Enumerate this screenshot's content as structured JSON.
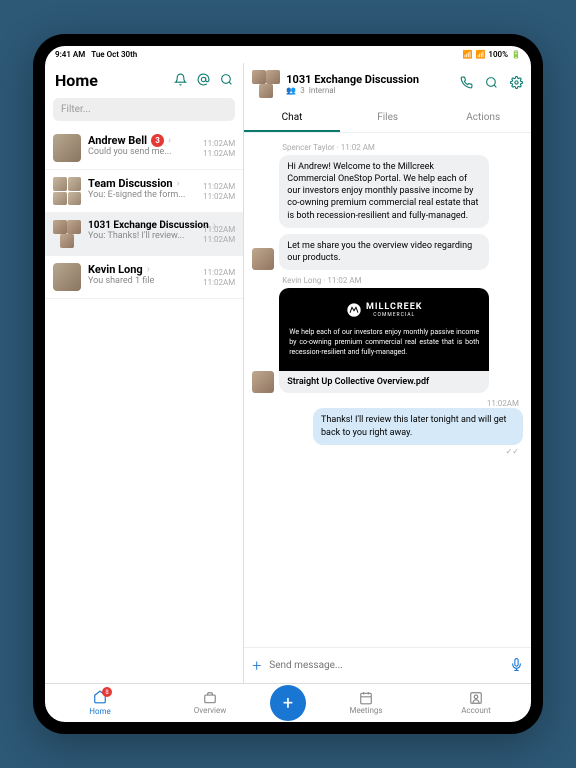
{
  "status": {
    "time": "9:41 AM",
    "date": "Tue Oct 30th",
    "wifi": "100%"
  },
  "home": {
    "title": "Home",
    "filter": "Filter..."
  },
  "conversations": [
    {
      "name": "Andrew Bell",
      "preview": "Could you send me...",
      "time": "11:02AM",
      "time2": "11:02AM",
      "badge": "3"
    },
    {
      "name": "Team Discussion",
      "preview": "You: E-signed the form...",
      "time": "11:02AM",
      "time2": "11:02AM"
    },
    {
      "name": "1031 Exchange Discussion",
      "preview": "You: Thanks! I'll review...",
      "time": "11:02AM",
      "time2": "11:02AM"
    },
    {
      "name": "Kevin Long",
      "preview": "You shared 1 file",
      "time": "11:02AM",
      "time2": "11:02AM"
    }
  ],
  "chat": {
    "title": "1031 Exchange Discussion",
    "members": "3",
    "scope": "Internal",
    "tabs": {
      "a": "Chat",
      "b": "Files",
      "c": "Actions"
    },
    "msgs": {
      "m1_meta": "Spencer Taylor · 11:02 AM",
      "m1": "Hi Andrew! Welcome to the Millcreek Commercial OneStop Portal. We help each of our investors enjoy monthly passive income by co-owning premium commercial real estate that is both recession-resilient and fully-managed.",
      "m2": "Let me share you the overview video regarding our products.",
      "m3_meta": "Kevin Long · 11:02 AM",
      "att_logo": "MILLCREEK",
      "att_sub": "COMMERCIAL",
      "att_text": "We help each of our investors enjoy monthly passive income by co-owning premium commercial real estate that is both recession-resilient and fully-managed.",
      "att_name": "Straight Up Collective Overview.pdf",
      "m4_time": "11:02AM",
      "m4": "Thanks! I'll review this later tonight and will get back to you right away."
    },
    "compose": "Send message..."
  },
  "nav": {
    "home": "Home",
    "overview": "Overview",
    "meetings": "Meetings",
    "account": "Account",
    "home_badge": "8"
  }
}
